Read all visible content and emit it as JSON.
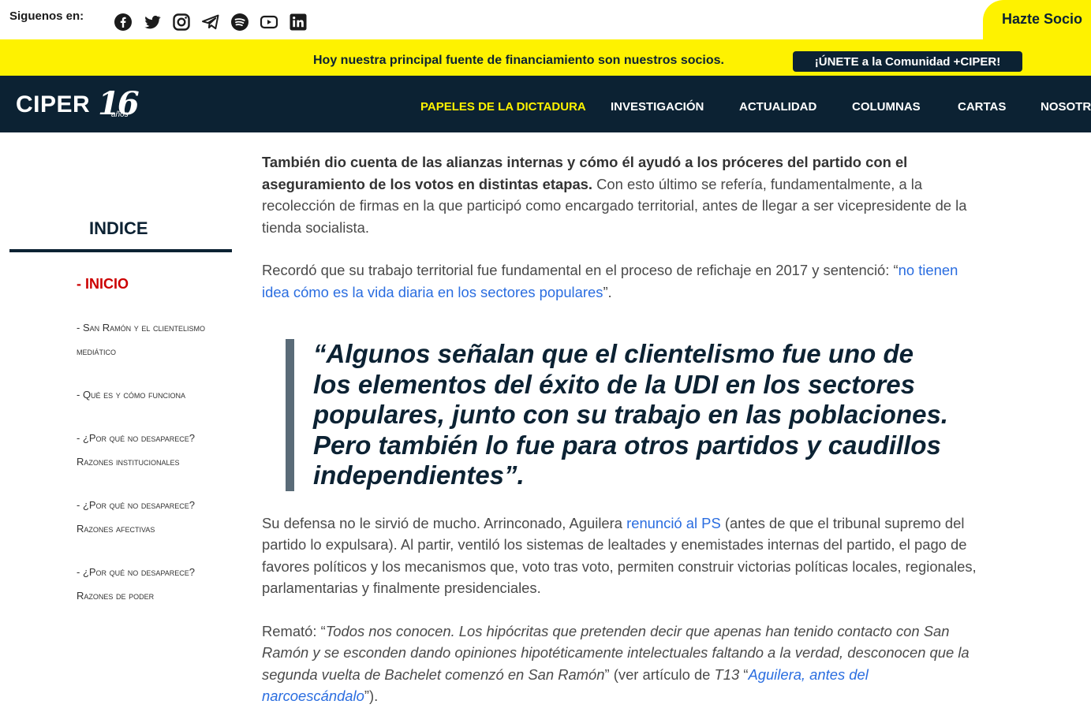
{
  "topbar": {
    "follow_label": "Siguenos en:",
    "social_icons": [
      "facebook-icon",
      "twitter-icon",
      "instagram-icon",
      "telegram-icon",
      "spotify-icon",
      "youtube-icon",
      "linkedin-icon"
    ],
    "cta": "Hazte Socio"
  },
  "banner": {
    "text": "Hoy nuestra principal fuente de financiamiento son nuestros socios.",
    "button": "¡ÚNETE a la Comunidad +CIPER!"
  },
  "nav": {
    "logo": "CIPER",
    "logo_years": "16",
    "logo_years_suffix": "años",
    "items": [
      "PAPELES DE LA DICTADURA",
      "INVESTIGACIÓN",
      "ACTUALIDAD",
      "COLUMNAS",
      "CARTAS",
      "NOSOTROS"
    ]
  },
  "sidebar": {
    "title": "INDICE",
    "items": [
      "- INICIO",
      "- San Ramón y el clientelismo mediático",
      "- Qué es y cómo funciona",
      "- ¿Por qué no desaparece? Razones institucionales",
      "- ¿Por qué no desaparece? Razones afectivas",
      "- ¿Por qué no desaparece? Razones de poder"
    ]
  },
  "article": {
    "p1_bold": "También dio cuenta de las alianzas internas y cómo él ayudó a los próceres del partido con el aseguramiento de los votos en distintas etapas.",
    "p1_rest": " Con esto último se refería, fundamentalmente, a la recolección de firmas en la que participó como encargado territorial, antes de llegar a ser vicepresidente de la tienda socialista.",
    "p2_text": "Recordó que su trabajo territorial fue fundamental en el proceso de refichaje en 2017 y sentenció: “",
    "p2_link": "no tienen idea cómo es la vida diaria en los sectores populares",
    "p2_end": "”.",
    "quote": "“Algunos señalan que el clientelismo fue uno de los elementos del éxito de la UDI en los sectores populares, junto con su trabajo en las poblaciones. Pero también lo fue para otros partidos y caudillos independientes”.",
    "p3_start": "Su defensa no le sirvió de mucho. Arrinconado, Aguilera ",
    "p3_link": "renunció al PS",
    "p3_rest": " (antes de que el tribunal supremo del partido lo expulsara). Al partir, ventiló los sistemas de lealtades y enemistades internas del partido, el pago de favores políticos y los mecanismos que, voto tras voto, permiten construir victorias políticas locales, regionales, parlamentarias y finalmente presidenciales.",
    "p4_start": "Remató: “",
    "p4_italic": "Todos nos conocen. Los hipócritas que pretenden decir que apenas han tenido contacto con San Ramón y se esconden dando opiniones hipotéticamente intelectuales faltando a la verdad, desconocen que la segunda vuelta de Bachelet comenzó en San Ramón",
    "p4_mid": "” (ver artículo de ",
    "p4_source": "T13",
    "p4_quote_open": " “",
    "p4_link": "Aguilera, antes del narcoescándalo",
    "p4_end": "”)."
  }
}
